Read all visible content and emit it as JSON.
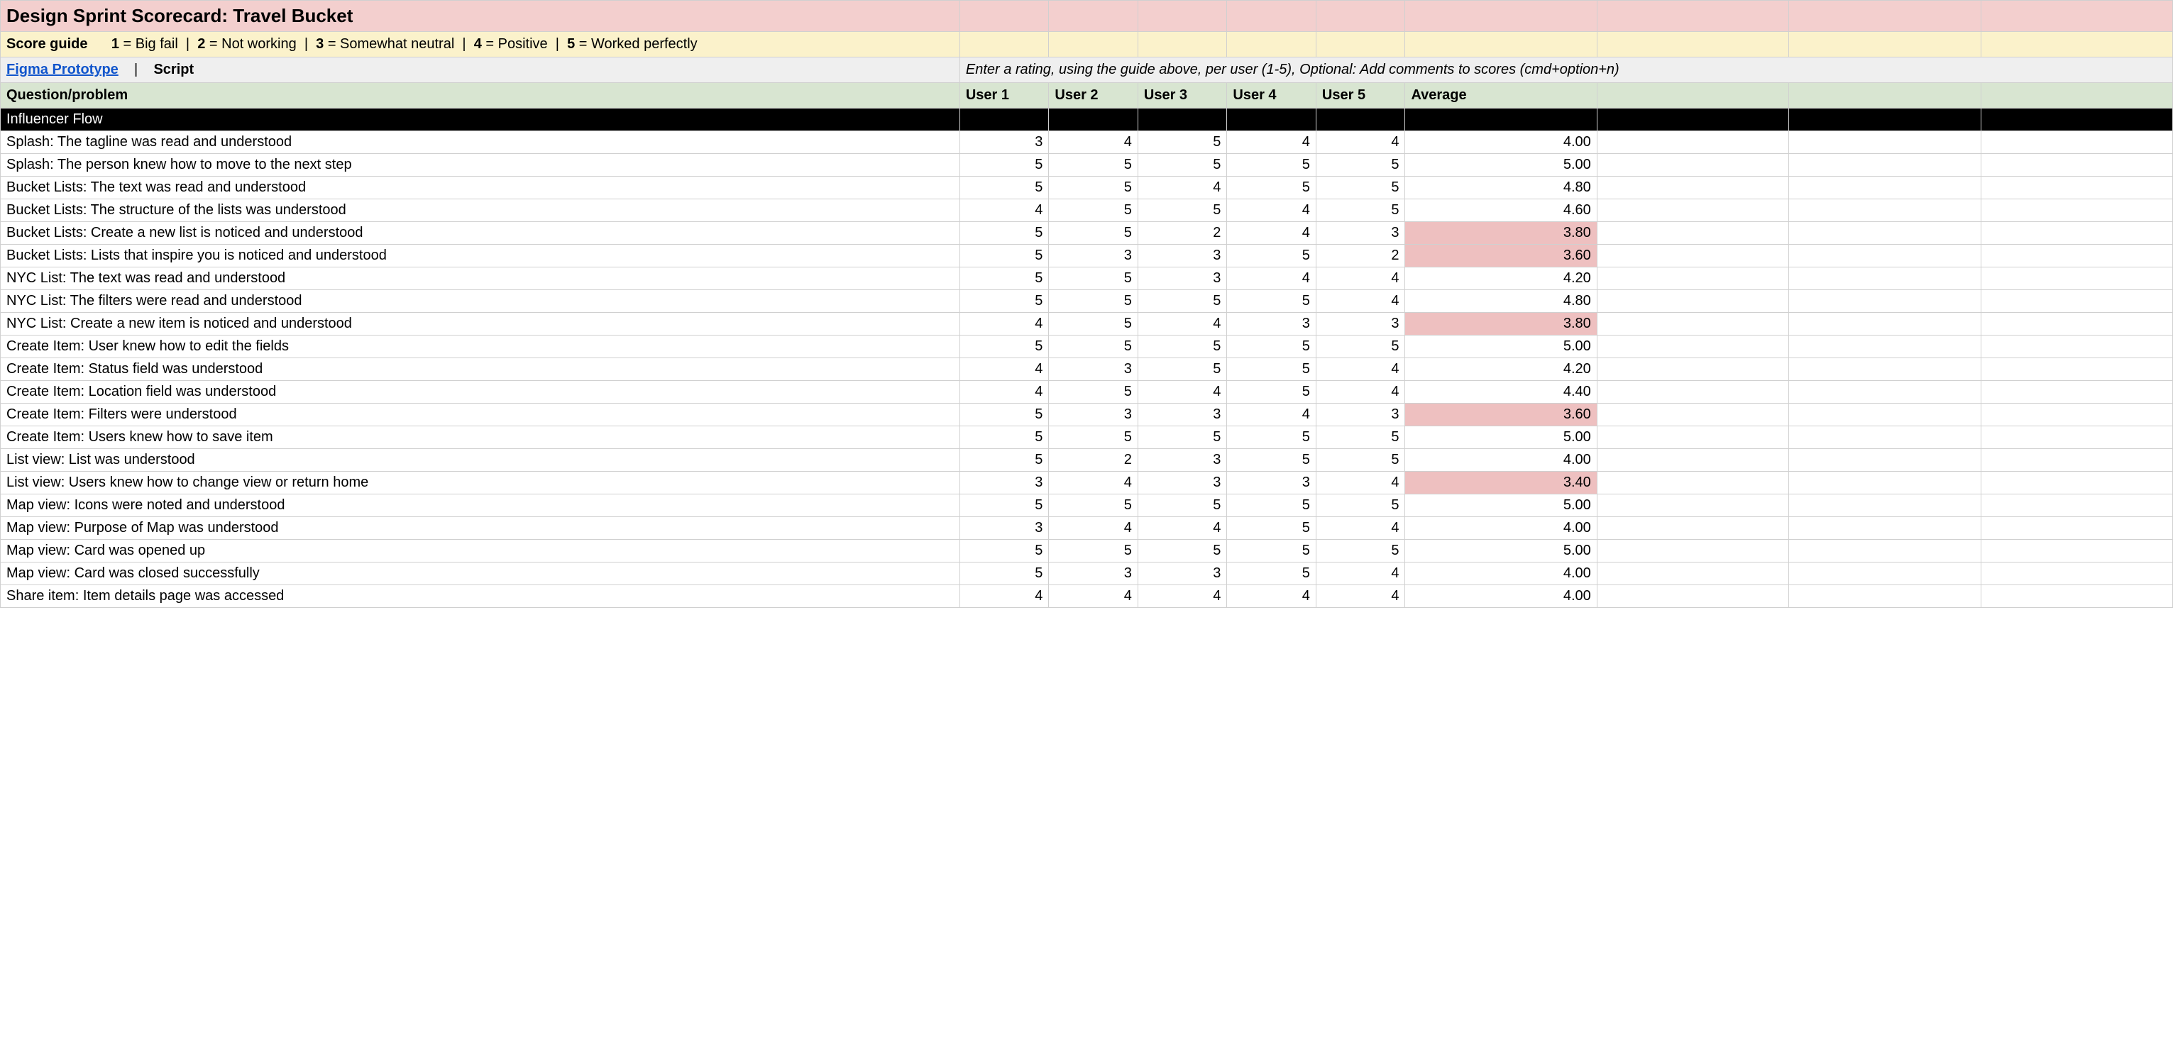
{
  "title": "Design Sprint Scorecard: Travel Bucket",
  "guide": {
    "label": "Score guide",
    "items": [
      {
        "n": "1",
        "t": "Big fail"
      },
      {
        "n": "2",
        "t": "Not working"
      },
      {
        "n": "3",
        "t": "Somewhat neutral"
      },
      {
        "n": "4",
        "t": "Positive"
      },
      {
        "n": "5",
        "t": "Worked perfectly"
      }
    ]
  },
  "links": {
    "figma": "Figma Prototype",
    "sep": "|",
    "script": "Script",
    "instructions": "Enter a rating, using the guide above, per user (1-5), Optional: Add comments to scores (cmd+option+n)"
  },
  "headers": {
    "question": "Question/problem",
    "users": [
      "User 1",
      "User 2",
      "User 3",
      "User 4",
      "User 5"
    ],
    "avg": "Average"
  },
  "section": "Influencer Flow",
  "low_threshold": 4.0,
  "rows": [
    {
      "q": "Splash: The tagline was read and understood",
      "v": [
        3,
        4,
        5,
        4,
        4
      ],
      "avg": "4.00"
    },
    {
      "q": "Splash: The person knew how to move to the next step",
      "v": [
        5,
        5,
        5,
        5,
        5
      ],
      "avg": "5.00"
    },
    {
      "q": "Bucket Lists: The text was read and understood",
      "v": [
        5,
        5,
        4,
        5,
        5
      ],
      "avg": "4.80"
    },
    {
      "q": "Bucket Lists: The structure of the lists was understood",
      "v": [
        4,
        5,
        5,
        4,
        5
      ],
      "avg": "4.60"
    },
    {
      "q": "Bucket Lists: Create a new list is noticed and understood",
      "v": [
        5,
        5,
        2,
        4,
        3
      ],
      "avg": "3.80"
    },
    {
      "q": "Bucket Lists: Lists that inspire you is noticed and understood",
      "v": [
        5,
        3,
        3,
        5,
        2
      ],
      "avg": "3.60"
    },
    {
      "q": "NYC List: The text was read and understood",
      "v": [
        5,
        5,
        3,
        4,
        4
      ],
      "avg": "4.20"
    },
    {
      "q": "NYC List: The filters were read and understood",
      "v": [
        5,
        5,
        5,
        5,
        4
      ],
      "avg": "4.80"
    },
    {
      "q": "NYC List: Create a new item is noticed and understood",
      "v": [
        4,
        5,
        4,
        3,
        3
      ],
      "avg": "3.80"
    },
    {
      "q": "Create Item: User knew how to edit the fields",
      "v": [
        5,
        5,
        5,
        5,
        5
      ],
      "avg": "5.00"
    },
    {
      "q": "Create Item: Status field was understood",
      "v": [
        4,
        3,
        5,
        5,
        4
      ],
      "avg": "4.20"
    },
    {
      "q": "Create Item: Location field was understood",
      "v": [
        4,
        5,
        4,
        5,
        4
      ],
      "avg": "4.40"
    },
    {
      "q": "Create Item: Filters were understood",
      "v": [
        5,
        3,
        3,
        4,
        3
      ],
      "avg": "3.60"
    },
    {
      "q": "Create Item: Users knew how to save item",
      "v": [
        5,
        5,
        5,
        5,
        5
      ],
      "avg": "5.00"
    },
    {
      "q": "List view: List was understood",
      "v": [
        5,
        2,
        3,
        5,
        5
      ],
      "avg": "4.00"
    },
    {
      "q": "List view: Users knew how to change view or return home",
      "v": [
        3,
        4,
        3,
        3,
        4
      ],
      "avg": "3.40"
    },
    {
      "q": "Map view: Icons were noted and understood",
      "v": [
        5,
        5,
        5,
        5,
        5
      ],
      "avg": "5.00"
    },
    {
      "q": "Map view: Purpose of Map was understood",
      "v": [
        3,
        4,
        4,
        5,
        4
      ],
      "avg": "4.00"
    },
    {
      "q": "Map view: Card was opened up",
      "v": [
        5,
        5,
        5,
        5,
        5
      ],
      "avg": "5.00"
    },
    {
      "q": "Map view: Card was closed successfully",
      "v": [
        5,
        3,
        3,
        5,
        4
      ],
      "avg": "4.00"
    },
    {
      "q": "Share item: Item details page was accessed",
      "v": [
        4,
        4,
        4,
        4,
        4
      ],
      "avg": "4.00"
    }
  ]
}
